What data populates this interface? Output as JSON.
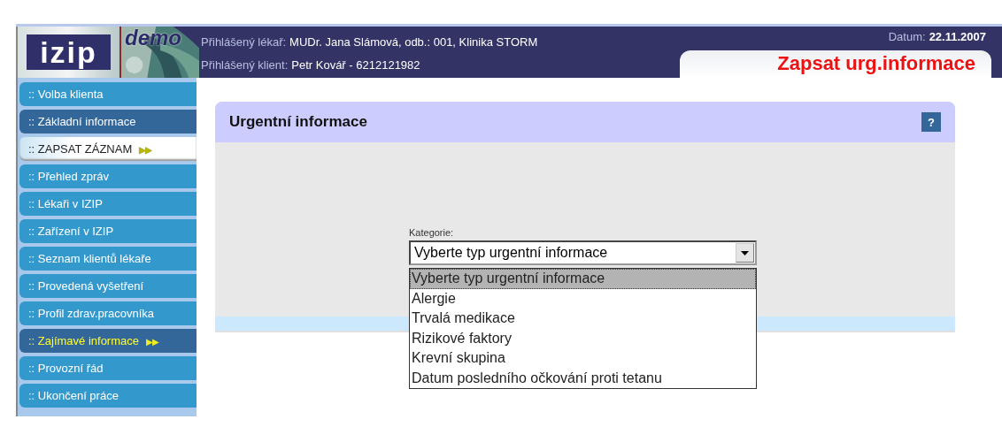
{
  "header": {
    "logo": "izip",
    "badge": "demo",
    "doctor_label": "Přihlášený lékař:",
    "doctor": "MUDr. Jana Slámová, odb.: 001, Klinika STORM",
    "client_label": "Přihlášený klient:",
    "client": "Petr Kovář - 6212121982",
    "date_label": "Datum:",
    "date": "22.11.2007",
    "page_title": "Zapsat urg.informace"
  },
  "sidebar": {
    "items": [
      {
        "label": ":: Volba klienta",
        "kind": "normal",
        "selected": false
      },
      {
        "label": ":: Základní informace",
        "kind": "dark",
        "selected": false
      },
      {
        "label": ":: ZAPSAT ZÁZNAM",
        "kind": "normal",
        "selected": true,
        "arrow": "▶▶"
      },
      {
        "label": ":: Přehled zpráv",
        "kind": "normal",
        "selected": false
      },
      {
        "label": ":: Lékaři v IZIP",
        "kind": "normal",
        "selected": false
      },
      {
        "label": ":: Zařízení v IZIP",
        "kind": "normal",
        "selected": false
      },
      {
        "label": ":: Seznam klientů lékaře",
        "kind": "normal",
        "selected": false
      },
      {
        "label": ":: Provedená vyšetření",
        "kind": "normal",
        "selected": false
      },
      {
        "label": ":: Profil zdrav.pracovníka",
        "kind": "normal",
        "selected": false
      },
      {
        "label": ":: Zajímavé informace",
        "kind": "featured",
        "selected": false,
        "arrow": "▶▶"
      },
      {
        "label": ":: Provozní řád",
        "kind": "normal",
        "selected": false
      },
      {
        "label": ":: Ukončení práce",
        "kind": "normal",
        "selected": false
      }
    ]
  },
  "panel": {
    "title": "Urgentní informace",
    "help": "?",
    "field": {
      "label": "Kategorie:",
      "value": "Vyberte typ urgentní informace",
      "expanded": true,
      "options": [
        {
          "label": "Vyberte typ urgentní informace",
          "selected": true
        },
        {
          "label": "Alergie",
          "selected": false
        },
        {
          "label": "Trvalá medikace",
          "selected": false
        },
        {
          "label": "Rizikové faktory",
          "selected": false
        },
        {
          "label": "Krevní skupina",
          "selected": false
        },
        {
          "label": "Datum posledního očkování proti tetanu",
          "selected": false
        }
      ]
    }
  }
}
